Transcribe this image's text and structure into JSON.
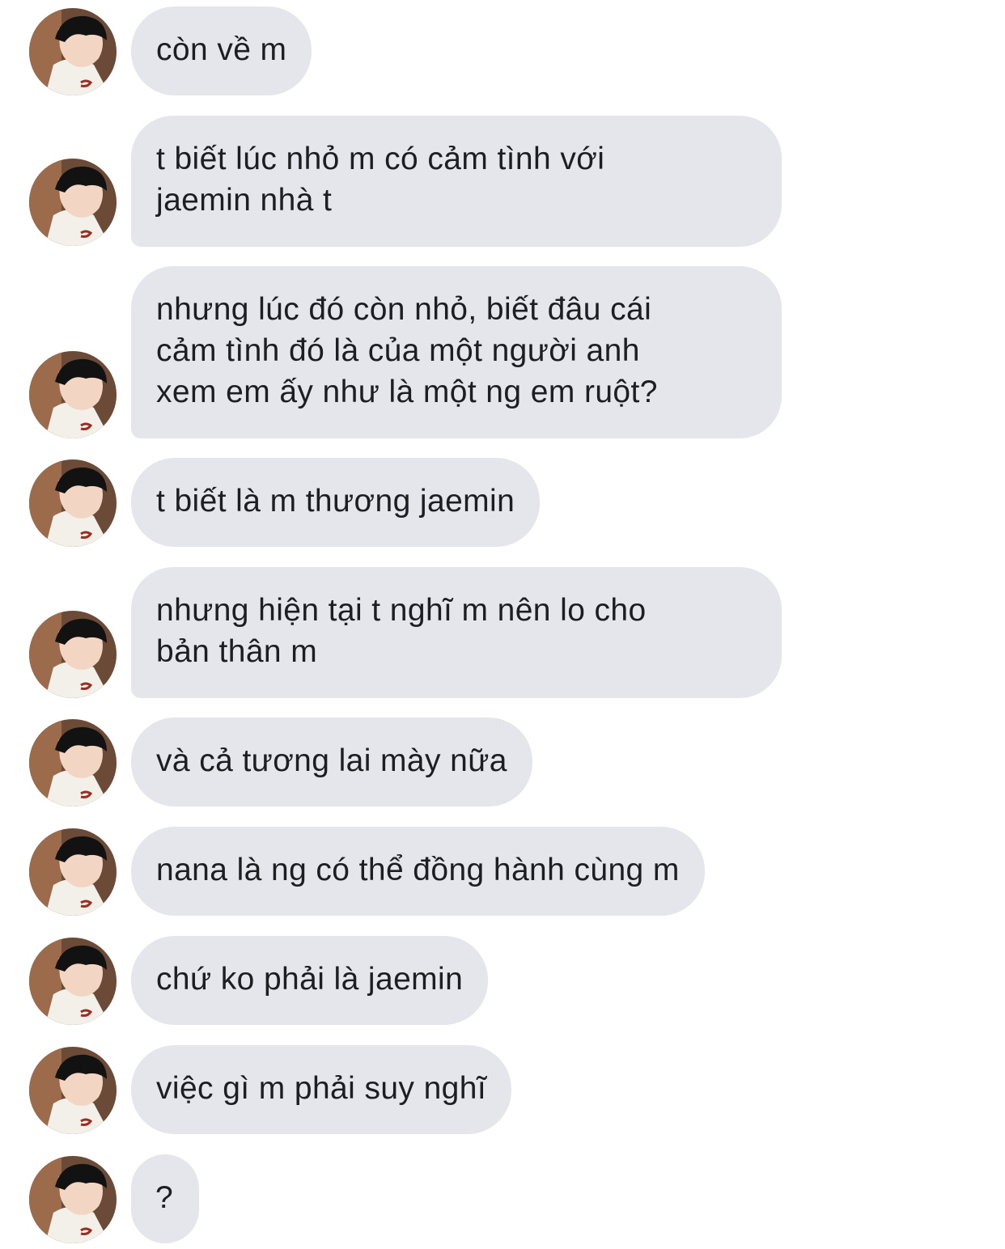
{
  "conversation": {
    "messages": [
      {
        "text": "còn về m"
      },
      {
        "lines": [
          "t biết lúc nhỏ m có cảm tình với",
          "jaemin nhà t"
        ]
      },
      {
        "lines": [
          "nhưng lúc đó còn nhỏ, biết đâu cái",
          "cảm tình đó là của một người anh",
          "xem em ấy như là một ng em ruột?"
        ]
      },
      {
        "text": "t biết là m thương jaemin"
      },
      {
        "lines": [
          "nhưng hiện tại t nghĩ m nên lo cho",
          "bản thân m"
        ]
      },
      {
        "text": "và cả tương lai mày nữa"
      },
      {
        "text": "nana là ng có thể đồng hành cùng m"
      },
      {
        "text": "chứ ko phải là jaemin"
      },
      {
        "text": "việc gì m phải suy nghĩ"
      },
      {
        "text": "?"
      }
    ],
    "bubble_color": "#e4e6eb",
    "text_color": "#1c1e21",
    "avatar_icon": "profile-photo-avatar"
  }
}
